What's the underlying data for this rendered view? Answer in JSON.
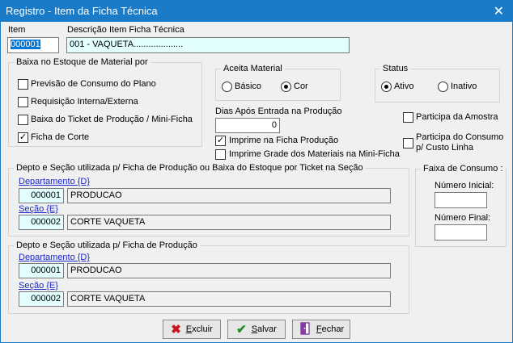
{
  "window": {
    "title": "Registro - Item da Ficha Técnica"
  },
  "item": {
    "label": "Item",
    "value": "000001"
  },
  "descricao": {
    "label": "Descrição Item Ficha Técnica",
    "value": "001 - VAQUETA...................."
  },
  "baixa": {
    "title": "Baixa no Estoque de Material por",
    "options": [
      {
        "label": "Previsão de Consumo do Plano",
        "checked": false
      },
      {
        "label": "Requisição Interna/Externa",
        "checked": false
      },
      {
        "label": "Baixa do Ticket de Produção / Mini-Ficha",
        "checked": false
      },
      {
        "label": "Ficha de Corte",
        "checked": true
      }
    ]
  },
  "aceita": {
    "title": "Aceita Material",
    "basico": "Básico",
    "cor": "Cor",
    "selected": "cor"
  },
  "status": {
    "title": "Status",
    "ativo": "Ativo",
    "inativo": "Inativo",
    "selected": "ativo"
  },
  "dias": {
    "label": "Dias Após Entrada na Produção",
    "value": "0"
  },
  "imprime_ficha": {
    "label": "Imprime na Ficha Produção",
    "checked": true
  },
  "imprime_grade": {
    "label": "Imprime Grade dos Materiais na Mini-Ficha",
    "checked": false
  },
  "participa_amostra": {
    "label": "Participa da Amostra",
    "checked": false
  },
  "participa_consumo": {
    "line1": "Participa do Consumo",
    "line2": "p/ Custo Linha",
    "checked": false
  },
  "depto1": {
    "title": "Depto e Seção utilizada p/ Ficha de Produção ou Baixa do Estoque por Ticket na Seção",
    "dept_label": "Departamento {D}",
    "dept_code": "000001",
    "dept_name": "PRODUCAO",
    "sec_label": "Seção {E}",
    "sec_code": "000002",
    "sec_name": "CORTE VAQUETA"
  },
  "depto2": {
    "title": "Depto e Seção utilizada p/ Ficha de Produção",
    "dept_label": "Departamento {D}",
    "dept_code": "000001",
    "dept_name": "PRODUCAO",
    "sec_label": "Seção {E}",
    "sec_code": "000002",
    "sec_name": "CORTE VAQUETA"
  },
  "faixa": {
    "title": "Faixa de Consumo :",
    "inicial_label": "Número Inicial:",
    "inicial_value": "",
    "final_label": "Número Final:",
    "final_value": ""
  },
  "buttons": {
    "excluir": {
      "hot": "E",
      "rest": "xcluir",
      "icon": "x-icon"
    },
    "salvar": {
      "hot": "S",
      "rest": "alvar",
      "icon": "check-icon"
    },
    "fechar": {
      "hot": "F",
      "rest": "echar",
      "icon": "door-icon"
    }
  },
  "colors": {
    "titlebar": "#1a7cc9",
    "code_bg": "#e2feff",
    "link": "#1a28c8",
    "excluir_icon": "#c8141e",
    "salvar_icon": "#1e8c28"
  }
}
